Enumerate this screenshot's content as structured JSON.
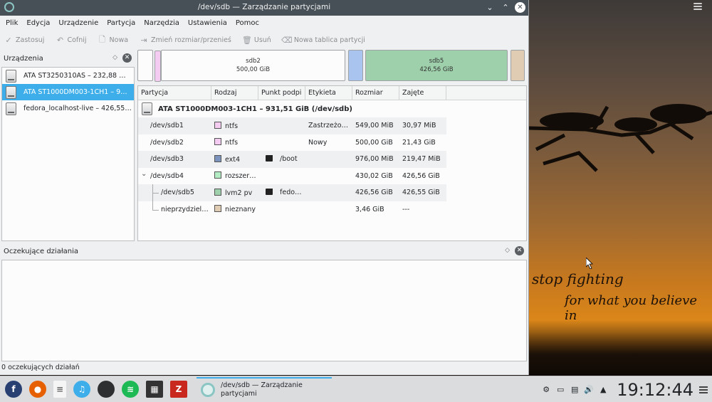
{
  "window": {
    "title": "/dev/sdb — Zarządzanie partycjami"
  },
  "menubar": {
    "items": [
      "Plik",
      "Edycja",
      "Urządzenie",
      "Partycja",
      "Narzędzia",
      "Ustawienia",
      "Pomoc"
    ]
  },
  "toolbar": {
    "apply": "Zastosuj",
    "undo": "Cofnij",
    "new": "Nowa",
    "resize": "Zmień rozmiar/przenieś",
    "delete": "Usuń",
    "new_table": "Nowa tablica partycji"
  },
  "devices": {
    "title": "Urządzenia",
    "items": [
      {
        "label": "ATA ST3250310AS – 232,88 …",
        "selected": false
      },
      {
        "label": "ATA ST1000DM003-1CH1 – 9…",
        "selected": true
      },
      {
        "label": "fedora_localhost-live – 426,55…",
        "selected": false
      }
    ]
  },
  "partition_map": {
    "sdb2_name": "sdb2",
    "sdb2_size": "500,00 GiB",
    "sdb5_name": "sdb5",
    "sdb5_size": "426,56 GiB"
  },
  "table": {
    "headers": [
      "Partycja",
      "Rodzaj",
      "Punkt podpi",
      "Etykieta",
      "Rozmiar",
      "Zajęte"
    ],
    "disk": "ATA ST1000DM003-1CH1 – 931,51 GiB (/dev/sdb)",
    "rows": [
      {
        "name": "/dev/sdb1",
        "type": "ntfs",
        "color": "#f4ccf2",
        "mount": "",
        "locked": false,
        "label": "Zastrzeżo…",
        "size": "549,00 MiB",
        "used": "30,97 MiB"
      },
      {
        "name": "/dev/sdb2",
        "type": "ntfs",
        "color": "#f4ccf2",
        "mount": "",
        "locked": false,
        "label": "Nowy",
        "size": "500,00 GiB",
        "used": "21,43 GiB"
      },
      {
        "name": "/dev/sdb3",
        "type": "ext4",
        "color": "#7b93bd",
        "mount": "/boot",
        "locked": true,
        "label": "",
        "size": "976,00 MiB",
        "used": "219,47 MiB"
      },
      {
        "name": "/dev/sdb4",
        "type": "rozszer…",
        "color": "#b3ecc3",
        "mount": "",
        "locked": false,
        "label": "",
        "size": "430,02 GiB",
        "used": "426,56 GiB"
      },
      {
        "name": "/dev/sdb5",
        "type": "lvm2 pv",
        "color": "#9ed1ab",
        "mount": "fedo…",
        "locked": true,
        "label": "",
        "size": "426,56 GiB",
        "used": "426,55 GiB"
      },
      {
        "name": "nieprzydziel…",
        "type": "nieznany",
        "color": "#dfccb2",
        "mount": "",
        "locked": false,
        "label": "",
        "size": "3,46 GiB",
        "used": "---"
      }
    ]
  },
  "pending": {
    "title": "Oczekujące działania"
  },
  "status": {
    "text": "0 oczekujących działań"
  },
  "taskbar": {
    "task_title_1": "/dev/sdb — Zarządzanie",
    "task_title_2": "partycjami",
    "clock": "19:12:44"
  },
  "wallpaper": {
    "quote1": "stop fighting",
    "quote2": "for what you believe in"
  }
}
